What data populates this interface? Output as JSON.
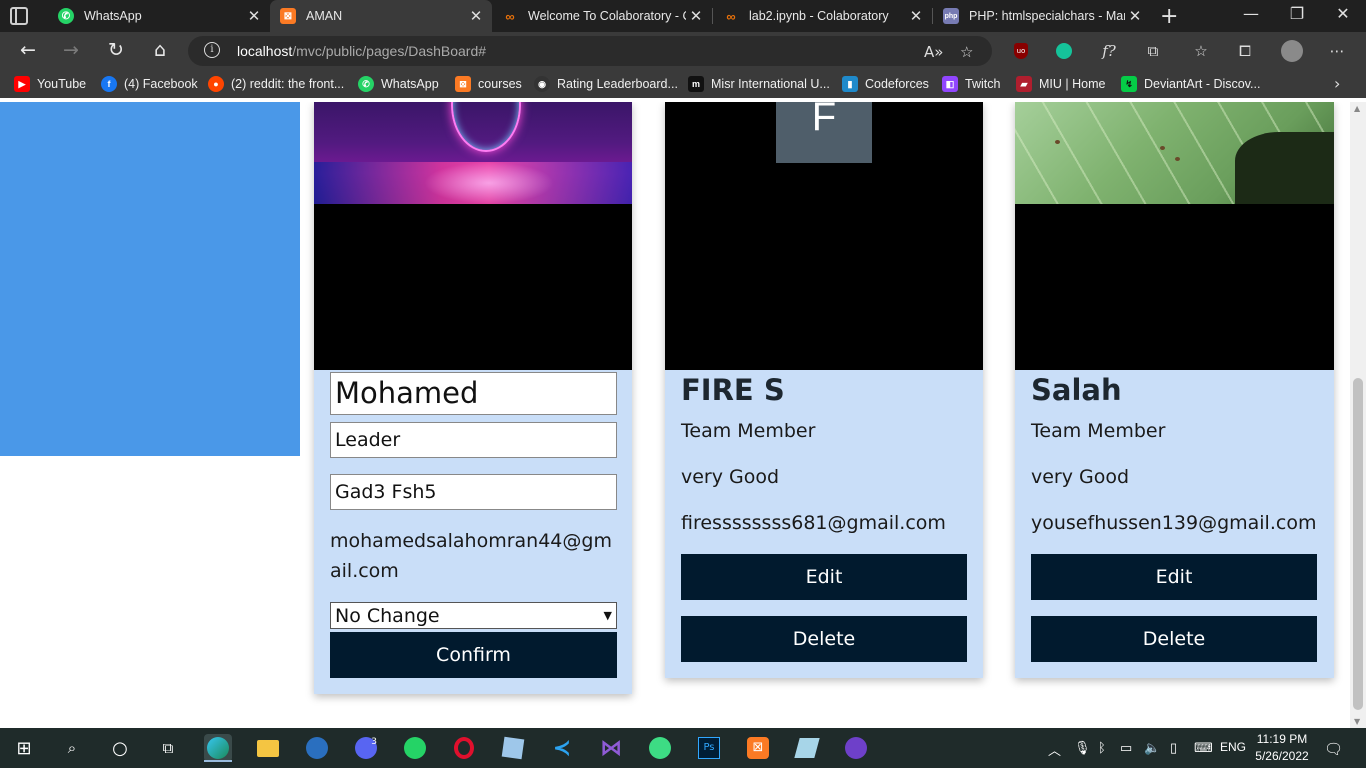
{
  "browser": {
    "tabs": [
      {
        "title": "WhatsApp",
        "icon": "whatsapp-icon",
        "color": "#25d366"
      },
      {
        "title": "AMAN",
        "icon": "xampp-icon",
        "color": "#fb7a24"
      },
      {
        "title": "Welcome To Colaboratory - C",
        "icon": "colab-icon",
        "color": "#e8710a"
      },
      {
        "title": "lab2.ipynb - Colaboratory",
        "icon": "colab-icon",
        "color": "#e8710a"
      },
      {
        "title": "PHP: htmlspecialchars - Manu",
        "icon": "php-icon",
        "color": "#777bb3"
      }
    ],
    "url_host": "localhost",
    "url_path": "/mvc/public/pages/DashBoard#",
    "bookmarks": [
      {
        "label": "YouTube",
        "icon": "youtube-icon",
        "color": "#ff0000",
        "glyph": "▶"
      },
      {
        "label": "(4) Facebook",
        "icon": "facebook-icon",
        "color": "#1877f2",
        "glyph": "f"
      },
      {
        "label": "(2) reddit: the front...",
        "icon": "reddit-icon",
        "color": "#ff4500",
        "glyph": "●"
      },
      {
        "label": "WhatsApp",
        "icon": "whatsapp-icon",
        "color": "#25d366",
        "glyph": "✆"
      },
      {
        "label": "courses",
        "icon": "xampp-icon",
        "color": "#fb7a24",
        "glyph": "⊠"
      },
      {
        "label": "Rating Leaderboard...",
        "icon": "leaderboard-icon",
        "color": "#333333",
        "glyph": "◉"
      },
      {
        "label": "Misr International U...",
        "icon": "miu-icon",
        "color": "#111111",
        "glyph": "m"
      },
      {
        "label": "Codeforces",
        "icon": "codeforces-icon",
        "color": "#1f8acb",
        "glyph": "▮"
      },
      {
        "label": "Twitch",
        "icon": "twitch-icon",
        "color": "#9146ff",
        "glyph": "◧"
      },
      {
        "label": "MIU | Home",
        "icon": "miu-home-icon",
        "color": "#b01e2e",
        "glyph": "▰"
      },
      {
        "label": "DeviantArt - Discov...",
        "icon": "deviantart-icon",
        "color": "#05cc47",
        "glyph": "↯"
      }
    ]
  },
  "dashboard": {
    "edit_card": {
      "name_value": "Mohamed",
      "role_value": "Leader",
      "description_value": "Gad3 Fsh5",
      "email": "mohamedsalahomran44@gmail.com",
      "select_value": "No Change",
      "confirm_label": "Confirm"
    },
    "members": [
      {
        "image_letter": "F",
        "name": "FIRE S",
        "role": "Team Member",
        "description": "very Good",
        "email": "firessssssss681@gmail.com",
        "edit_label": "Edit",
        "delete_label": "Delete"
      },
      {
        "name": "Salah",
        "role": "Team Member",
        "description": "very Good",
        "email": "yousefhussen139@gmail.com",
        "edit_label": "Edit",
        "delete_label": "Delete"
      }
    ]
  },
  "taskbar": {
    "language": "ENG",
    "time": "11:19 PM",
    "date": "5/26/2022",
    "chat_badge": "3"
  },
  "colors": {
    "sidebar_blue": "#4a98e8",
    "card_bg": "#c9def8",
    "button_dark": "#011a2e"
  }
}
